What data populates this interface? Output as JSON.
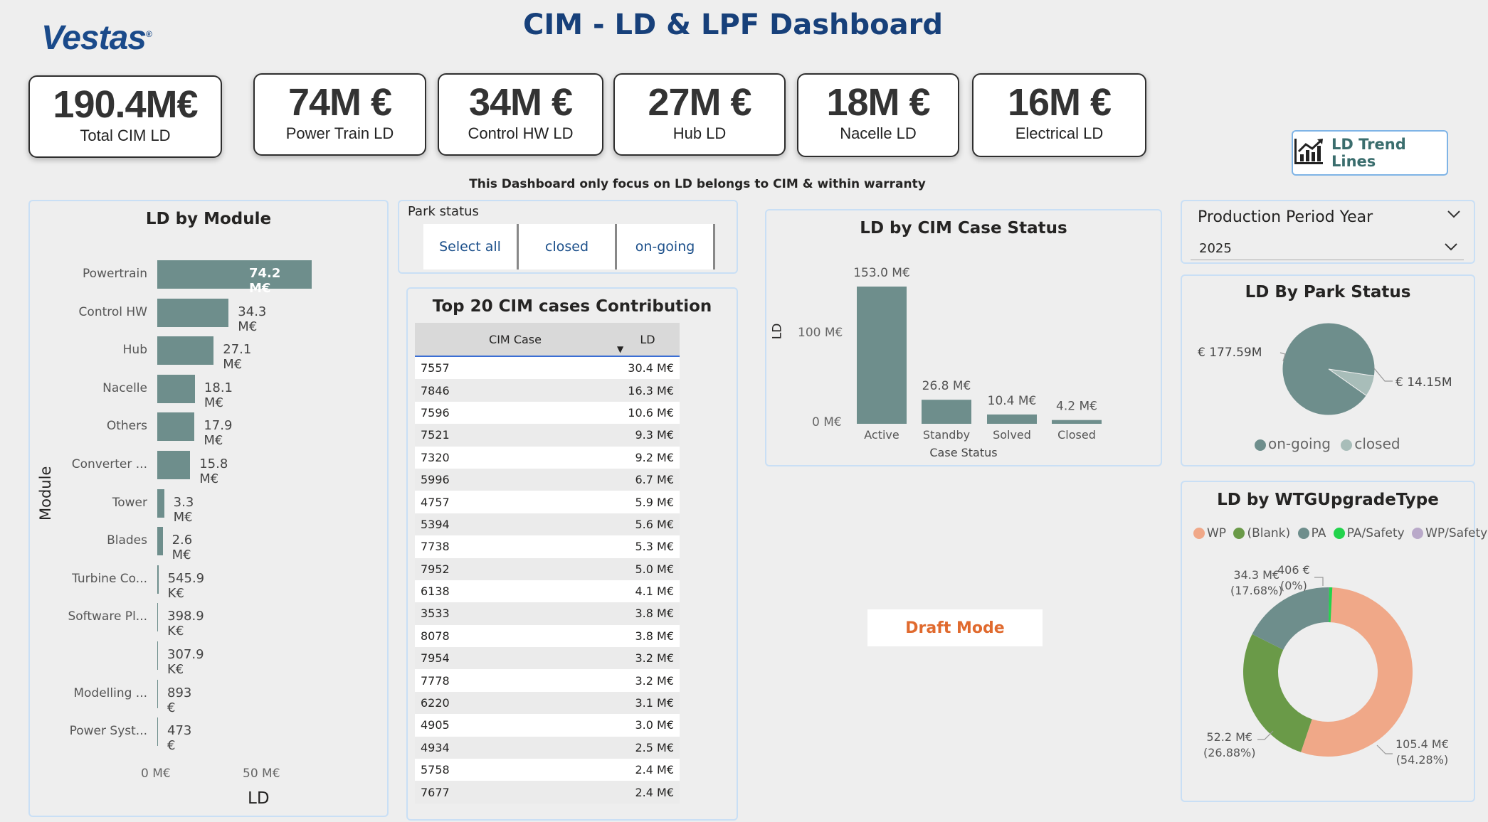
{
  "header": {
    "logo": "Vestas",
    "logo_mark": "®",
    "title": "CIM - LD & LPF Dashboard"
  },
  "kpis": [
    {
      "value": "190.4M€",
      "label": "Total CIM LD"
    },
    {
      "value": "74M €",
      "label": "Power Train LD"
    },
    {
      "value": "34M €",
      "label": "Control HW LD"
    },
    {
      "value": "27M €",
      "label": "Hub LD"
    },
    {
      "value": "18M €",
      "label": "Nacelle LD"
    },
    {
      "value": "16M €",
      "label": "Electrical LD"
    }
  ],
  "trend_button": {
    "label": "LD Trend Lines",
    "icon": "chart-trend-icon"
  },
  "note": "This Dashboard only focus on LD belongs to CIM & within warranty",
  "module_chart": {
    "title": "LD by Module",
    "ylabel": "Module",
    "xlabel": "LD",
    "ticks": [
      "0 M€",
      "50 M€"
    ],
    "rows": [
      {
        "label": "Powertrain",
        "value": 74.2,
        "text": "74.2 M€"
      },
      {
        "label": "Control HW",
        "value": 34.3,
        "text": "34.3 M€"
      },
      {
        "label": "Hub",
        "value": 27.1,
        "text": "27.1 M€"
      },
      {
        "label": "Nacelle",
        "value": 18.1,
        "text": "18.1 M€"
      },
      {
        "label": "Others",
        "value": 17.9,
        "text": "17.9 M€"
      },
      {
        "label": "Converter ...",
        "value": 15.8,
        "text": "15.8 M€"
      },
      {
        "label": "Tower",
        "value": 3.3,
        "text": "3.3 M€"
      },
      {
        "label": "Blades",
        "value": 2.6,
        "text": "2.6 M€"
      },
      {
        "label": "Turbine Co...",
        "value": 0.5459,
        "text": "545.9 K€"
      },
      {
        "label": "Software Pl...",
        "value": 0.3989,
        "text": "398.9 K€"
      },
      {
        "label": "",
        "value": 0.3079,
        "text": "307.9 K€"
      },
      {
        "label": "Modelling ...",
        "value": 0.000893,
        "text": "893 €"
      },
      {
        "label": "Power Syst...",
        "value": 0.000473,
        "text": "473 €"
      }
    ]
  },
  "park_slicer": {
    "title": "Park status",
    "options": [
      "Select all",
      "closed",
      "on-going"
    ]
  },
  "top20": {
    "title": "Top 20 CIM cases Contribution",
    "col_case": "CIM Case",
    "col_ld": "LD",
    "rows": [
      [
        "7557",
        "30.4 M€"
      ],
      [
        "7846",
        "16.3 M€"
      ],
      [
        "7596",
        "10.6 M€"
      ],
      [
        "7521",
        "9.3 M€"
      ],
      [
        "7320",
        "9.2 M€"
      ],
      [
        "5996",
        "6.7 M€"
      ],
      [
        "4757",
        "5.9 M€"
      ],
      [
        "5394",
        "5.6 M€"
      ],
      [
        "7738",
        "5.3 M€"
      ],
      [
        "7952",
        "5.0 M€"
      ],
      [
        "6138",
        "4.1 M€"
      ],
      [
        "3533",
        "3.8 M€"
      ],
      [
        "8078",
        "3.8 M€"
      ],
      [
        "7954",
        "3.2 M€"
      ],
      [
        "7778",
        "3.2 M€"
      ],
      [
        "6220",
        "3.1 M€"
      ],
      [
        "4905",
        "3.0 M€"
      ],
      [
        "4934",
        "2.5 M€"
      ],
      [
        "5758",
        "2.4 M€"
      ],
      [
        "7677",
        "2.4 M€"
      ]
    ]
  },
  "case_status": {
    "title": "LD by CIM Case Status",
    "ylabel": "LD",
    "xlabel": "Case Status",
    "ticks": [
      "100 M€",
      "0 M€"
    ]
  },
  "draft": "Draft Mode",
  "filter": {
    "title": "Production Period Year",
    "value": "2025"
  },
  "park_pie": {
    "title": "LD By Park Status",
    "labels": [
      "€ 177.59M",
      "€ 14.15M"
    ],
    "legend": [
      "on-going",
      "closed"
    ]
  },
  "wtg_donut": {
    "title": "LD by WTGUpgradeType",
    "legend": [
      "WP",
      "(Blank)",
      "PA",
      "PA/Safety",
      "WP/Safety"
    ],
    "labels": [
      {
        "value": "34.3 M€",
        "pct": "(17.68%)"
      },
      {
        "value": "406 €",
        "pct": "(0%)"
      },
      {
        "value": "52.2 M€",
        "pct": "(26.88%)"
      },
      {
        "value": "105.4 M€",
        "pct": "(54.28%)"
      }
    ]
  },
  "colors": {
    "bar": "#6e8e8c",
    "title_blue": "#17407a",
    "wp": "#f0a888",
    "blank": "#6a9a48",
    "pa": "#6e8e8c",
    "pa_safety": "#22d34c",
    "wp_safety": "#b9a9c9",
    "closed": "#a8bdb9",
    "draft": "#e06a2e"
  },
  "chart_data": [
    {
      "type": "bar",
      "title": "LD by CIM Case Status",
      "categories": [
        "Active",
        "Standby",
        "Solved",
        "Closed"
      ],
      "series": [
        {
          "values": [
            153.0,
            26.8,
            10.4,
            4.2
          ]
        }
      ],
      "value_labels": [
        "153.0 M€",
        "26.8 M€",
        "10.4 M€",
        "4.2 M€"
      ],
      "xlabel": "Case Status",
      "ylabel": "LD",
      "ylim": [
        0,
        160
      ]
    },
    {
      "type": "pie",
      "title": "LD By Park Status",
      "categories": [
        "on-going",
        "closed"
      ],
      "values": [
        177.59,
        14.15
      ]
    },
    {
      "type": "pie",
      "title": "LD by WTGUpgradeType",
      "categories": [
        "WP",
        "(Blank)",
        "PA",
        "PA/Safety"
      ],
      "values": [
        105.4,
        52.2,
        34.3,
        0.000406
      ]
    }
  ]
}
